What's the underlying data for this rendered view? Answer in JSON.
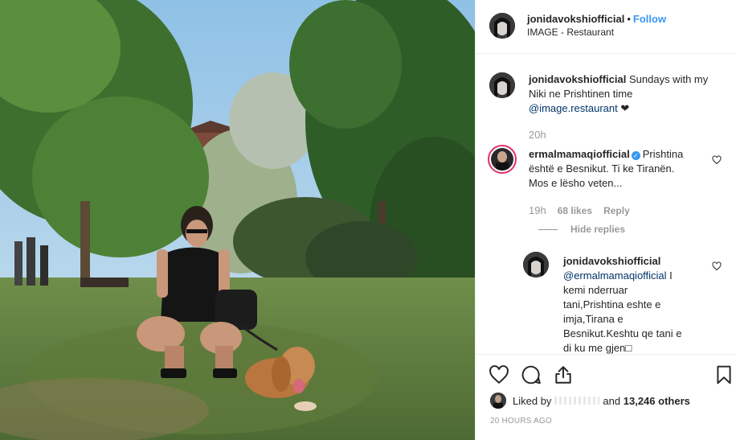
{
  "post": {
    "author": "jonidavokshiofficial",
    "separator": "•",
    "follow_label": "Follow",
    "location": "IMAGE - Restaurant"
  },
  "caption": {
    "author": "jonidavokshiofficial",
    "text_line1": "Sundays with my",
    "text_line2": "Niki ne Prishtinen time",
    "mention": "@image.restaurant",
    "emoji": "❤",
    "time": "20h"
  },
  "comment1": {
    "author": "ermalmamaqiofficial",
    "verified": "✓",
    "text_line1": "Prishtina",
    "text_line2": "është e Besnikut. Ti ke Tiranën.",
    "text_line3": "Mos e lësho veten...",
    "time": "19h",
    "likes": "68 likes",
    "reply_label": "Reply",
    "hide_replies": "Hide replies"
  },
  "reply1": {
    "author": "jonidavokshiofficial",
    "mention": "@ermalmamaqiofficial",
    "text_after_mention": " I",
    "line2": "kemi nderruar",
    "line3": "tani,Prishtina eshte e",
    "line4": "imja,Tirana e",
    "line5": "Besnikut.Keshtu qe tani e",
    "line6": "di ku me gjen□"
  },
  "footer": {
    "liked_prefix": "Liked by",
    "liked_suffix": "and",
    "others": "13,246 others",
    "time_ago": "20 HOURS AGO"
  },
  "icons": {
    "like": "heart-icon",
    "comment": "comment-icon",
    "share": "share-icon",
    "save": "bookmark-icon"
  }
}
